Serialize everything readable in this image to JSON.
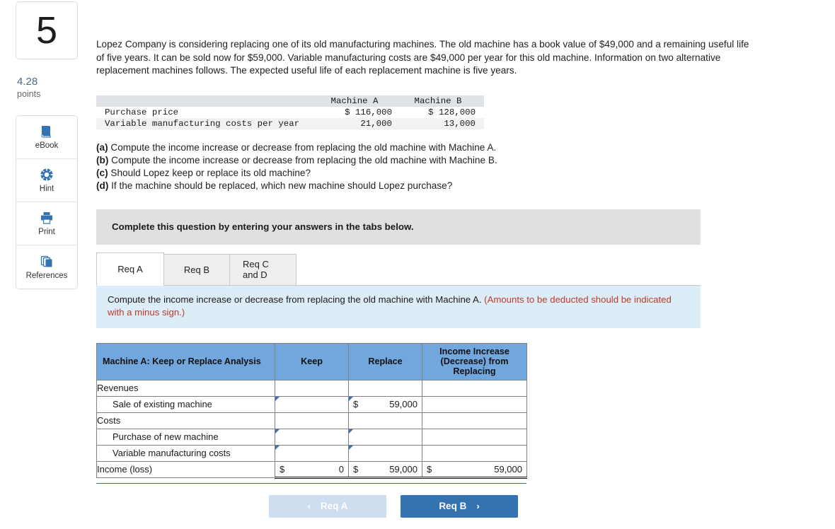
{
  "question": {
    "number": "5",
    "points_value": "4.28",
    "points_label": "points"
  },
  "tools": [
    {
      "label": "eBook",
      "icon": "book-icon"
    },
    {
      "label": "Hint",
      "icon": "lifebuoy-icon"
    },
    {
      "label": "Print",
      "icon": "printer-icon"
    },
    {
      "label": "References",
      "icon": "copy-stack-icon"
    }
  ],
  "stem": "Lopez Company is considering replacing one of its old manufacturing machines. The old machine has a book value of $49,000 and a remaining useful life of five years. It can be sold now for $59,000. Variable manufacturing costs are $49,000 per year for this old machine. Information on two alternative replacement machines follows. The expected useful life of each replacement machine is five years.",
  "exhibit": {
    "columns": [
      "",
      "Machine A",
      "Machine B"
    ],
    "rows": [
      {
        "label": "Purchase price",
        "a": "$ 116,000",
        "b": "$ 128,000"
      },
      {
        "label": "Variable manufacturing costs per year",
        "a": "21,000",
        "b": "13,000"
      }
    ]
  },
  "requirements": [
    {
      "tag": "(a)",
      "text": "Compute the income increase or decrease from replacing the old machine with Machine A."
    },
    {
      "tag": "(b)",
      "text": "Compute the income increase or decrease from replacing the old machine with Machine B."
    },
    {
      "tag": "(c)",
      "text": "Should Lopez keep or replace its old machine?"
    },
    {
      "tag": "(d)",
      "text": "If the machine should be replaced, which new machine should Lopez purchase?"
    }
  ],
  "instruction_bar": "Complete this question by entering your answers in the tabs below.",
  "tabs": [
    {
      "label": "Req A",
      "active": true
    },
    {
      "label": "Req B",
      "active": false
    },
    {
      "label": "Req C and D",
      "active": false
    }
  ],
  "info_bar": {
    "main": "Compute the income increase or decrease from replacing the old machine with Machine A. ",
    "warning": "(Amounts to be deducted should be indicated with a minus sign.)"
  },
  "answer_grid": {
    "headers": [
      "Machine A: Keep or Replace Analysis",
      "Keep",
      "Replace",
      "Income Increase (Decrease) from Replacing"
    ],
    "rows": [
      {
        "label": "Revenues",
        "indent": false,
        "keep": "",
        "replace": "",
        "delta": "",
        "keep_entry": false,
        "replace_entry": false,
        "total": false
      },
      {
        "label": "Sale of existing machine",
        "indent": true,
        "keep": "",
        "replace": "59,000",
        "replace_cur": "$",
        "delta": "",
        "keep_entry": true,
        "replace_entry": true,
        "total": false
      },
      {
        "label": "Costs",
        "indent": false,
        "keep": "",
        "replace": "",
        "delta": "",
        "keep_entry": false,
        "replace_entry": false,
        "total": false
      },
      {
        "label": "Purchase of new machine",
        "indent": true,
        "keep": "",
        "replace": "",
        "delta": "",
        "keep_entry": true,
        "replace_entry": true,
        "total": false
      },
      {
        "label": "Variable manufacturing costs",
        "indent": true,
        "keep": "",
        "replace": "",
        "delta": "",
        "keep_entry": true,
        "replace_entry": true,
        "total": false
      },
      {
        "label": "Income (loss)",
        "indent": false,
        "keep": "0",
        "keep_cur": "$",
        "replace": "59,000",
        "replace_cur": "$",
        "delta": "59,000",
        "delta_cur": "$",
        "keep_entry": false,
        "replace_entry": false,
        "total": true
      }
    ]
  },
  "nav": {
    "prev_label": "Req A",
    "prev_chevron": "‹",
    "next_label": "Req B",
    "next_chevron": "›"
  },
  "colors": {
    "grid_header_blue": "#72a7dd",
    "info_bar_blue": "#dcedf7",
    "instruction_gray": "#e0e0e0",
    "entry_border_blue": "#3f72b0",
    "next_button_blue": "#3572b0",
    "prev_button_blue": "#ccdef0",
    "warning_red": "#c0392b",
    "points_blue": "#4a6b8a"
  }
}
